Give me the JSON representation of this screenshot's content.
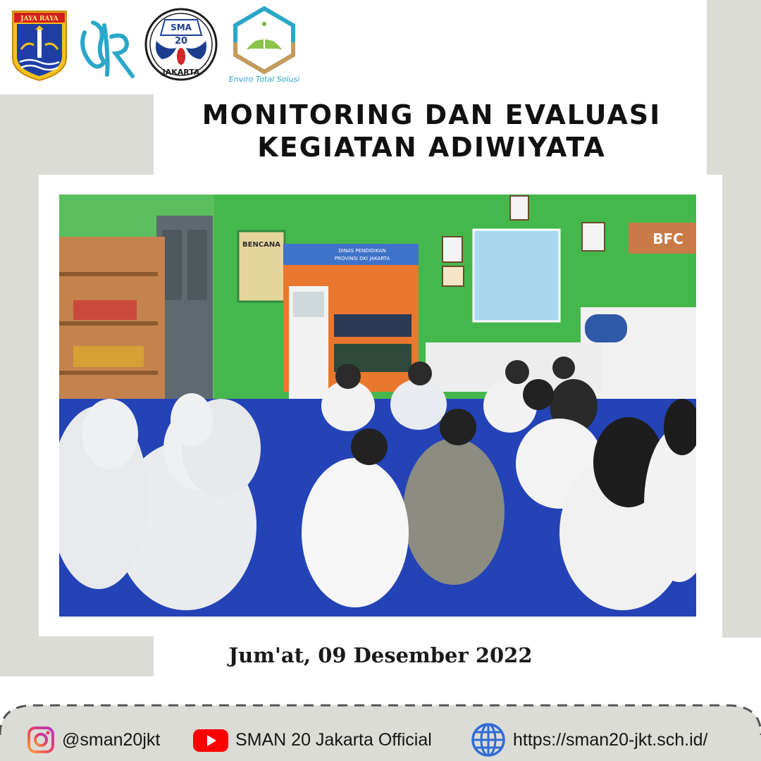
{
  "header": {
    "logos": [
      {
        "name": "DKI Jakarta crest",
        "text": "JAYA RAYA"
      },
      {
        "name": "DJR monogram",
        "text": ""
      },
      {
        "name": "SMA 20 Jakarta emblem",
        "text_top": "SMA",
        "text_num": "20",
        "text_bottom": "JAKARTA"
      },
      {
        "name": "Enviro Total Solusi logo",
        "text": "Enviro Total Solusi"
      }
    ]
  },
  "title": {
    "line1": "MONITORING DAN EVALUASI",
    "line2": "KEGIATAN ADIWIYATA"
  },
  "photo": {
    "description_icon": "group-discussion-photo",
    "signs": {
      "dinas": "DINAS PENDIDIKAN",
      "provinsi": "PROVINSI DKI JAKARTA",
      "bencana": "BENCANA",
      "bfc": "BFC"
    }
  },
  "date": "Jum'at, 09 Desember 2022",
  "footer": {
    "instagram": {
      "icon": "instagram-icon",
      "label": "@sman20jkt"
    },
    "youtube": {
      "icon": "youtube-icon",
      "label": "SMAN 20 Jakarta Official"
    },
    "website": {
      "icon": "globe-icon",
      "label": "https://sman20-jkt.sch.id/"
    }
  },
  "colors": {
    "accent_gray": "#dcdcd7",
    "instagram_gradient": [
      "#f9a13a",
      "#e4405f",
      "#b935c8"
    ],
    "youtube_red": "#ff0000",
    "globe_blue": "#2f6bd6"
  }
}
